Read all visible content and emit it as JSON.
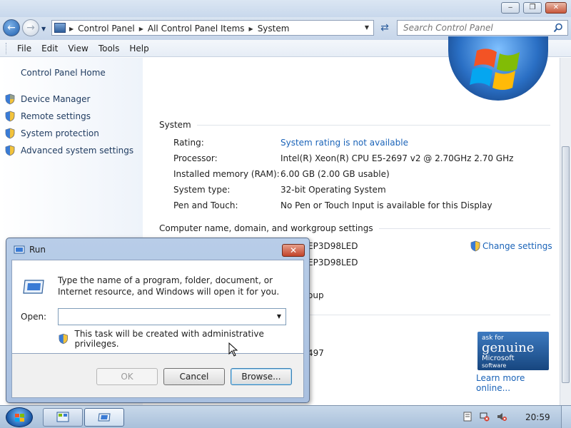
{
  "window": {
    "caption_buttons": {
      "minimize": "‒",
      "maximize": "❐",
      "close": "✕"
    }
  },
  "address_bar": {
    "breadcrumbs": [
      "Control Panel",
      "All Control Panel Items",
      "System"
    ],
    "search_placeholder": "Search Control Panel"
  },
  "menu": [
    "File",
    "Edit",
    "View",
    "Tools",
    "Help"
  ],
  "sidebar": {
    "home": "Control Panel Home",
    "links": [
      "Device Manager",
      "Remote settings",
      "System protection",
      "Advanced system settings"
    ]
  },
  "system": {
    "heading": "System",
    "rows": [
      {
        "label": "Rating:",
        "value": "System rating is not available",
        "link": true
      },
      {
        "label": "Processor:",
        "value": "Intel(R) Xeon(R) CPU E5-2697 v2 @ 2.70GHz   2.70 GHz",
        "link": false
      },
      {
        "label": "Installed memory (RAM):",
        "value": "6.00 GB (2.00 GB usable)",
        "link": false
      },
      {
        "label": "System type:",
        "value": "32-bit Operating System",
        "link": false
      },
      {
        "label": "Pen and Touch:",
        "value": "No Pen or Touch Input is available for this Display",
        "link": false
      }
    ]
  },
  "computer_name": {
    "heading": "Computer name, domain, and workgroup settings",
    "visible_fragments": [
      "EP3D98LED",
      "EP3D98LED",
      "oup",
      "497"
    ],
    "change_settings": "Change settings"
  },
  "genuine": {
    "ask": "ask for",
    "word": "genuine",
    "brand": "Microsoft",
    "sub": "software",
    "learn_more": "Learn more online..."
  },
  "run_dialog": {
    "title": "Run",
    "description": "Type the name of a program, folder, document, or Internet resource, and Windows will open it for you.",
    "open_label": "Open:",
    "open_value": "",
    "admin_note": "This task will be created with administrative privileges.",
    "buttons": {
      "ok": "OK",
      "cancel": "Cancel",
      "browse": "Browse..."
    }
  },
  "taskbar": {
    "clock": "20:59"
  },
  "colors": {
    "link": "#1a63b8",
    "title_bar": "#c8d8ec",
    "close_red": "#c2432a"
  },
  "icons": [
    "back-arrow-icon",
    "forward-arrow-icon",
    "refresh-icon",
    "search-icon",
    "shield-icon",
    "windows-flag-icon",
    "run-program-icon"
  ]
}
